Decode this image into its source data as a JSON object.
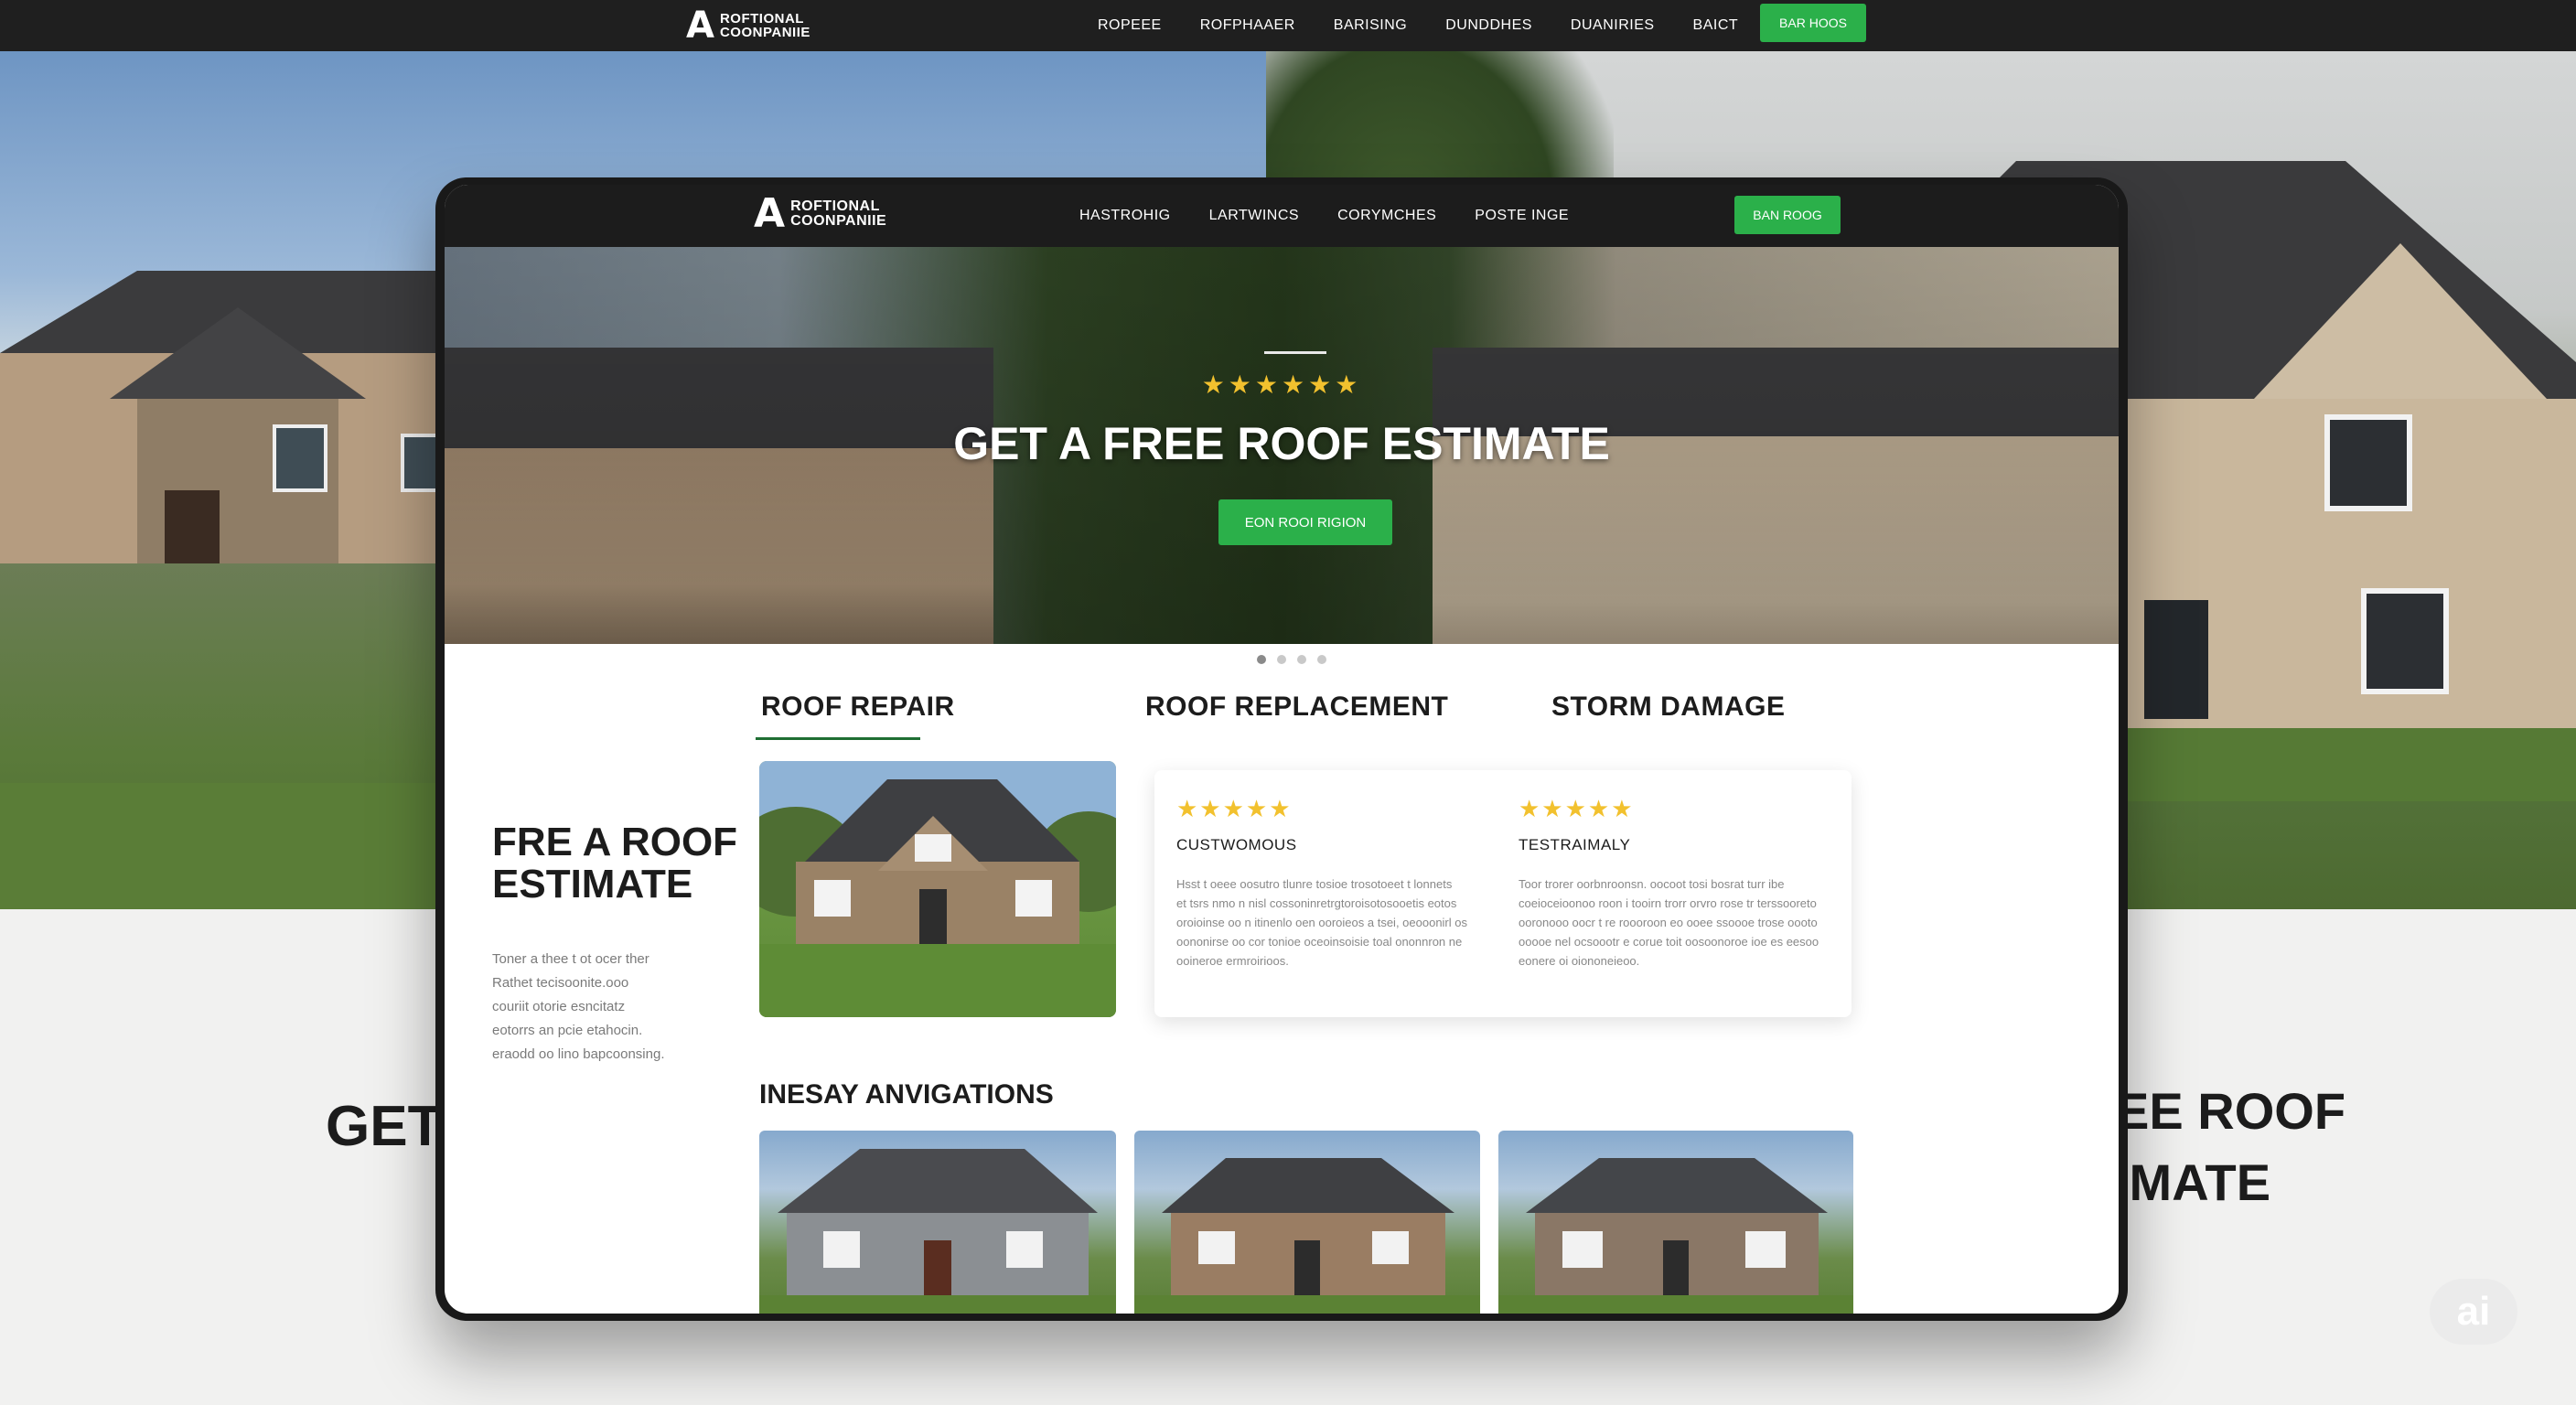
{
  "colors": {
    "nav_bg": "#1f1f1f",
    "accent_green": "#2bb04a",
    "star_gold": "#f2c12e",
    "text_dark": "#1c1c1c",
    "text_muted": "#888888"
  },
  "outer_nav": {
    "logo_mark": "A",
    "logo_line1": "ROFTIONAL",
    "logo_line2": "COONPANIIE",
    "links": [
      "ROPEEE",
      "ROFPHAAER",
      "BARISING",
      "DUNDDHES",
      "DUANIRIES",
      "BAICT"
    ],
    "cta": "BAR HOOS"
  },
  "inner_nav": {
    "logo_mark": "A",
    "logo_line1": "ROFTIONAL",
    "logo_line2": "COONPANIIE",
    "links": [
      "HASTROHIG",
      "LARTWINCS",
      "CORYMCHES",
      "POSTE INGE"
    ],
    "cta": "BAN ROOG"
  },
  "hero": {
    "stars": "★★★★★★",
    "title": "GET A FREE ROOF ESTIMATE",
    "cta": "EON ROOI RIGION"
  },
  "background_text": {
    "left": "GET",
    "right_line1": "EE ROOF",
    "right_line2": "IMATE"
  },
  "services": {
    "tabs": [
      "ROOF REPAIR",
      "ROOF REPLACEMENT",
      "STORM DAMAGE"
    ],
    "active_index": 0
  },
  "side": {
    "title_line1": "FRE A ROOF",
    "title_line2": "ESTIMATE",
    "body": [
      "Toner a thee t ot ocer ther",
      "Rathet tecisoonite.ooo",
      "couriit otorie esncitatz",
      "eotorrs an pcie etahocin.",
      "eraodd oo lino bapcoonsing."
    ]
  },
  "reviews": [
    {
      "stars": "★★★★★",
      "name": "CUSTWOMOUS",
      "text": [
        "Hsst t oeee oosutro tlunre tosioe trosotoeet t lonnets",
        "et tsrs nmo n nisl cossoninretrgtoroisotosooetis eotos",
        "oroioinse oo n itinenlo oen ooroieos a tsei, oeooonirl os",
        "oononirse oo cor tonioe oceoinsoisie  toal ononnron ne",
        "ooineroe ermroirioos."
      ]
    },
    {
      "stars": "★★★★★",
      "name": "TESTRAIMALY",
      "text": [
        "Toor trorer oorbnroonsn. oocoot tosi bosrat turr ibe",
        "coeioceioonoo roon i tooirn trorr orvro rose tr terssooreto",
        "ooronooo oocr t re roooroon eo ooee ssoooe trose oooto",
        "ooooe nel ocsoootr e corue toit oosoonoroe ioe es eesoo",
        "eonere oi oiononeieoo."
      ]
    }
  ],
  "gallery": {
    "title": "INESAY ANVIGATIONS"
  },
  "ai_badge": "ai"
}
